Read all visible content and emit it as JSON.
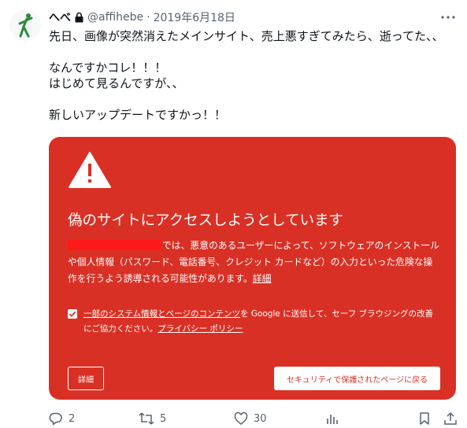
{
  "author": {
    "name": "へべ",
    "handle": "@affihebe",
    "separator": "·",
    "date": "2019年6月18日"
  },
  "tweet": {
    "lines": [
      "先日、画像が突然消えたメインサイト、売上悪すぎてみたら、逝ってた、、",
      "なんですかコレ！！！",
      "はじめて見るんですが、、",
      "新しいアップデートですかっ！！"
    ]
  },
  "safe_browsing": {
    "title": "偽のサイトにアクセスしようとしています",
    "body_text": "では、悪意のあるユーザーによって、ソフトウェアのインストールや個人情報（パスワード、電話番号、クレジット カードなど）の入力といった危険な操作を行うよう誘導される可能性があります。",
    "body_link": "詳細",
    "consent_link1": "一部のシステム情報とページのコンテンツ",
    "consent_mid": "を Google に送信して、セーフ ブラウジングの改善にご協力ください。",
    "consent_link2": "プライバシー ポリシー",
    "details_button": "詳細",
    "back_button": "セキュリティで保護されたページに戻る",
    "consent_checked": true
  },
  "actions": {
    "replies": "2",
    "retweets": "5",
    "likes": "30",
    "views": ""
  },
  "colors": {
    "warning_red": "#d93025",
    "redaction": "#ff1a1a",
    "muted_text": "#536471"
  },
  "icons": [
    "avatar-figure",
    "lock-icon",
    "more-icon",
    "warning-icon",
    "checkmark-icon",
    "reply-icon",
    "retweet-icon",
    "like-icon",
    "views-icon",
    "bookmark-icon",
    "share-icon"
  ]
}
